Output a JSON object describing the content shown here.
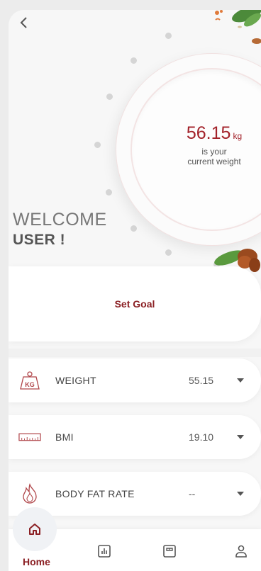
{
  "header": {
    "back_icon": "chevron-left-icon"
  },
  "dial": {
    "weight_value": "56.15",
    "weight_unit": "kg",
    "caption_line1": "is your",
    "caption_line2": "current weight",
    "accent_color": "#a3222a"
  },
  "welcome": {
    "line1": "WELCOME",
    "line2": "USER !"
  },
  "goal": {
    "label": "Set Goal"
  },
  "metrics": [
    {
      "label": "WEIGHT",
      "value": "55.15",
      "icon": "kg-weight-icon"
    },
    {
      "label": "BMI",
      "value": "19.10",
      "icon": "ruler-icon"
    },
    {
      "label": "BODY FAT RATE",
      "value": "--",
      "icon": "flame-icon"
    }
  ],
  "nav": {
    "home_label": "Home",
    "items": [
      "home-icon",
      "chart-icon",
      "scale-icon",
      "profile-icon"
    ]
  },
  "colors": {
    "brand": "#8b2024",
    "background": "#f7f7f7"
  }
}
